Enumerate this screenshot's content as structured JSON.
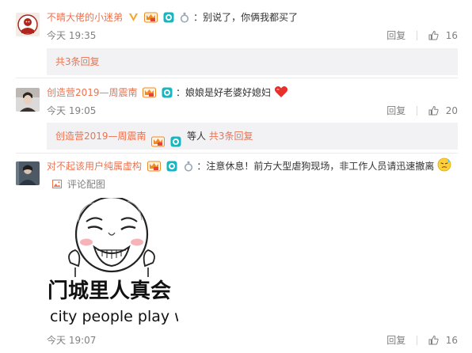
{
  "comments": [
    {
      "username": "不晴大佬的小迷弟",
      "separator": "：",
      "text": "别说了，你俩我都买了",
      "time": "今天 19:35",
      "reply_label": "回复",
      "like_count": "16",
      "reply_summary": {
        "text": "共3条回复"
      }
    },
    {
      "username": "创造营2019—周震南",
      "separator": "：",
      "text": "娘娘是好老婆好媳妇",
      "time": "今天 19:05",
      "reply_label": "回复",
      "like_count": "20",
      "reply_summary": {
        "user": "创造营2019—周震南",
        "middle": "等人",
        "text": "共3条回复"
      }
    },
    {
      "username": "对不起该用户纯属虚构",
      "separator": "：",
      "text": "注意休息！前方大型虐狗现场，非工作人员请迅速撤离",
      "picture_label": "评论配图",
      "image_caption_cn": "门城里人真会",
      "image_caption_en": "city people play w",
      "time": "今天 19:07",
      "reply_label": "回复",
      "like_count": "16"
    }
  ],
  "icons": {
    "verified": "verified-v-icon",
    "vip": "vip-crown-icon",
    "eye": "weibo-eye-badge-icon",
    "ring": "ring-badge-icon",
    "like": "thumbs-up-icon",
    "heart": "red-heart-emoji-icon",
    "cold_sweat": "sweat-emoji-icon",
    "picture": "picture-icon"
  },
  "colors": {
    "username": "#eb7350",
    "meta": "#808080",
    "reply_bg": "#f2f2f5"
  }
}
